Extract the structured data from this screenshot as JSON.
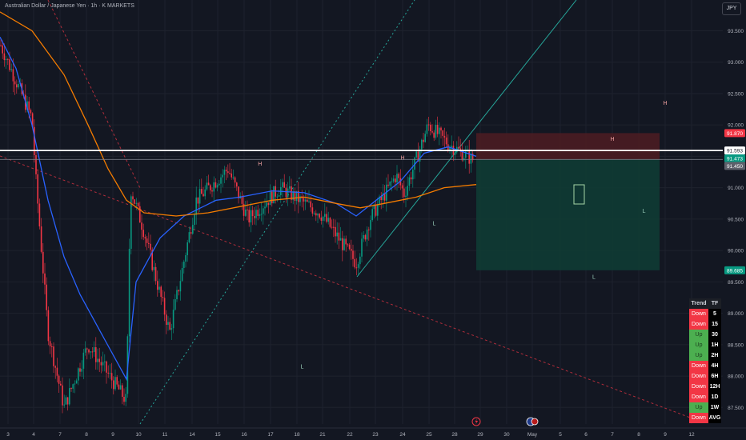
{
  "header": {
    "title": "Australian Dollar / Japanese Yen · 1h · K MARKETS",
    "currency": "JPY"
  },
  "colors": {
    "background": "#131722",
    "grid": "#1e222d",
    "up": "#089981",
    "down": "#f23645",
    "ma_fast": "#2962ff",
    "ma_slow": "#f57c00",
    "resistance": "#ffffff",
    "stop_zone": "#4a1c22",
    "target_zone": "#0f3b34",
    "trendline": "#26a69a",
    "downtrend": "#f23645"
  },
  "chart_data": {
    "type": "candlestick",
    "symbol": "AUDJPY",
    "interval": "1h",
    "y_axis": {
      "labels": [
        93.5,
        93.0,
        92.5,
        92.0,
        91.5,
        91.0,
        90.5,
        90.0,
        89.5,
        89.0,
        88.5,
        88.0,
        87.5
      ],
      "ylim": [
        87.3,
        93.85
      ]
    },
    "x_axis": {
      "labels": [
        "3",
        "4",
        "7",
        "8",
        "9",
        "10",
        "11",
        "14",
        "15",
        "16",
        "17",
        "18",
        "21",
        "22",
        "23",
        "24",
        "25",
        "28",
        "29",
        "30",
        "May",
        "5",
        "6",
        "7",
        "8",
        "9",
        "12"
      ]
    },
    "price_tags": [
      {
        "value": "91.870",
        "kind": "stop",
        "color": "#f23645"
      },
      {
        "value": "91.593",
        "kind": "resistance",
        "color": "#ffffff"
      },
      {
        "value": "91.473",
        "kind": "last",
        "color": "#089981"
      },
      {
        "value": "91.450",
        "kind": "entry",
        "color": "#5d606b"
      },
      {
        "value": "89.685",
        "kind": "target",
        "color": "#089981"
      }
    ],
    "levels": {
      "resistance": 91.593,
      "stop": 91.87,
      "entry": 91.45,
      "target": 89.685
    },
    "series": [
      {
        "name": "",
        "type": "ohlc",
        "values": []
      },
      {
        "name": "",
        "type": "ma",
        "values": []
      },
      {
        "name": "",
        "type": "ma",
        "values": []
      }
    ],
    "annotations": [
      {
        "text": "H",
        "x": 9.6,
        "y": 91.35
      },
      {
        "text": "H",
        "x": 15.0,
        "y": 91.45
      },
      {
        "text": "H",
        "x": 23.0,
        "y": 91.75
      },
      {
        "text": "H",
        "x": 25.0,
        "y": 92.32
      },
      {
        "text": "L",
        "x": 11.2,
        "y": 88.12
      },
      {
        "text": "L",
        "x": 16.2,
        "y": 90.4
      },
      {
        "text": "L",
        "x": 22.3,
        "y": 89.55
      },
      {
        "text": "L",
        "x": 24.2,
        "y": 90.6
      }
    ]
  },
  "trend_table": {
    "header": [
      "Trend",
      "TF"
    ],
    "rows": [
      {
        "trend": "Down",
        "tf": "5"
      },
      {
        "trend": "Down",
        "tf": "15"
      },
      {
        "trend": "Up",
        "tf": "30"
      },
      {
        "trend": "Up",
        "tf": "1H"
      },
      {
        "trend": "Up",
        "tf": "2H"
      },
      {
        "trend": "Down",
        "tf": "4H"
      },
      {
        "trend": "Down",
        "tf": "6H"
      },
      {
        "trend": "Down",
        "tf": "12H"
      },
      {
        "trend": "Down",
        "tf": "1D"
      },
      {
        "trend": "Up",
        "tf": "1W"
      },
      {
        "trend": "Down",
        "tf": "AVG"
      }
    ]
  }
}
